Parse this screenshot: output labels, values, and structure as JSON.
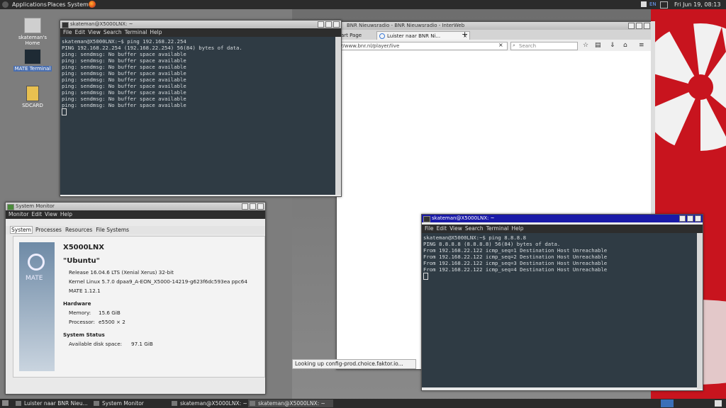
{
  "top_panel": {
    "menus": [
      "Applications",
      "Places",
      "System"
    ],
    "keyboard_layout": "EN",
    "clock": "Fri Jun 19, 08:13"
  },
  "desktop": {
    "icons": [
      {
        "label": "skateman's Home",
        "icon": "folder-home-icon"
      },
      {
        "label": "MATE Terminal",
        "icon": "terminal-icon"
      },
      {
        "label": "SDCARD",
        "icon": "sdcard-icon"
      }
    ]
  },
  "terminal1": {
    "title": "skateman@X5000LNX: ~",
    "menu": [
      "File",
      "Edit",
      "View",
      "Search",
      "Terminal",
      "Help"
    ],
    "lines": [
      "skateman@X5000LNX:~$ ping 192.168.22.254",
      "PING 192.168.22.254 (192.168.22.254) 56(84) bytes of data.",
      "ping: sendmsg: No buffer space available",
      "ping: sendmsg: No buffer space available",
      "ping: sendmsg: No buffer space available",
      "ping: sendmsg: No buffer space available",
      "ping: sendmsg: No buffer space available",
      "ping: sendmsg: No buffer space available",
      "ping: sendmsg: No buffer space available",
      "ping: sendmsg: No buffer space available",
      "ping: sendmsg: No buffer space available"
    ]
  },
  "browser": {
    "title": "BNR Nieuwsradio - BNR Nieuwsradio - InterWeb",
    "tabs": [
      "art Page",
      "Luister naar BNR Ni..."
    ],
    "url": "//www.bnr.nl/player/live",
    "search_placeholder": "Search",
    "status": "Looking up config-prod.choice.faktor.io..."
  },
  "sysmon": {
    "title": "System Monitor",
    "menu": [
      "Monitor",
      "Edit",
      "View",
      "Help"
    ],
    "tabs": [
      "System",
      "Processes",
      "Resources",
      "File Systems"
    ],
    "logo_text": "MATE",
    "hostname": "X5000LNX",
    "distro": "\"Ubuntu\"",
    "release": "Release 16.04.6 LTS (Xenial Xerus) 32-bit",
    "kernel": "Kernel Linux 5.7.0 dpaa9_A-EON_X5000-14219-g623f6dc593ea ppc64",
    "mate": "MATE 1.12.1",
    "hardware_heading": "Hardware",
    "memory_label": "Memory:",
    "memory_value": "15.6 GiB",
    "processor_label": "Processor:",
    "processor_value": "e5500 × 2",
    "status_heading": "System Status",
    "disk_label": "Available disk space:",
    "disk_value": "97.1 GiB"
  },
  "terminal2": {
    "title": "skateman@X5000LNX: ~",
    "menu": [
      "File",
      "Edit",
      "View",
      "Search",
      "Terminal",
      "Help"
    ],
    "lines": [
      "skateman@X5000LNX:~$ ping 8.8.8.8",
      "PING 8.8.8.8 (8.8.8.8) 56(84) bytes of data.",
      "From 192.168.22.122 icmp_seq=1 Destination Host Unreachable",
      "From 192.168.22.122 icmp_seq=2 Destination Host Unreachable",
      "From 192.168.22.122 icmp_seq=3 Destination Host Unreachable",
      "From 192.168.22.122 icmp_seq=4 Destination Host Unreachable"
    ]
  },
  "taskbar": {
    "tasks": [
      "Luister naar BNR Nieu...",
      "System Monitor",
      "skateman@X5000LNX: ~",
      "skateman@X5000LNX: ~"
    ]
  }
}
